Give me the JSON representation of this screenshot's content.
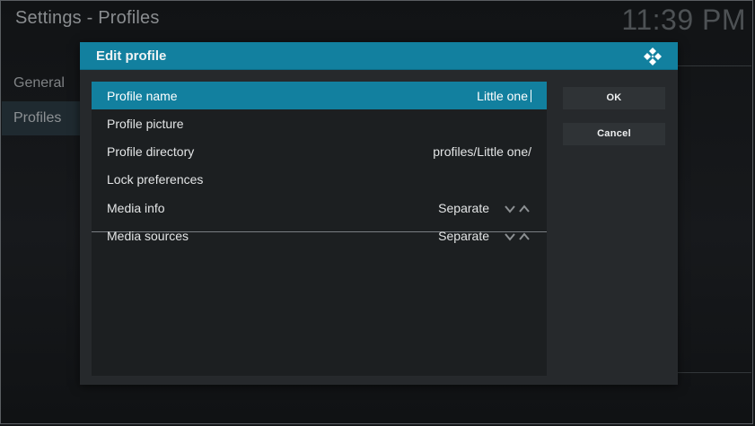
{
  "app": {
    "title": "Settings - Profiles",
    "clock": "11:39 PM"
  },
  "side_menu": {
    "items": [
      {
        "label": "General",
        "active": false
      },
      {
        "label": "Profiles",
        "active": true
      }
    ]
  },
  "dialog": {
    "title": "Edit profile",
    "logo_icon": "kodi-logo-icon",
    "accent_color": "#12809f",
    "settings": {
      "profile_name": {
        "label": "Profile name",
        "value": "Little one"
      },
      "profile_picture": {
        "label": "Profile picture"
      },
      "profile_directory": {
        "label": "Profile directory",
        "value": "profiles/Little one/"
      },
      "lock_preferences": {
        "label": "Lock preferences"
      },
      "media_info": {
        "label": "Media info",
        "value": "Separate",
        "icon": "spin-arrows-icon"
      },
      "media_sources": {
        "label": "Media sources",
        "value": "Separate",
        "icon": "spin-arrows-icon"
      }
    },
    "buttons": {
      "ok_label": "OK",
      "cancel_label": "Cancel"
    }
  }
}
